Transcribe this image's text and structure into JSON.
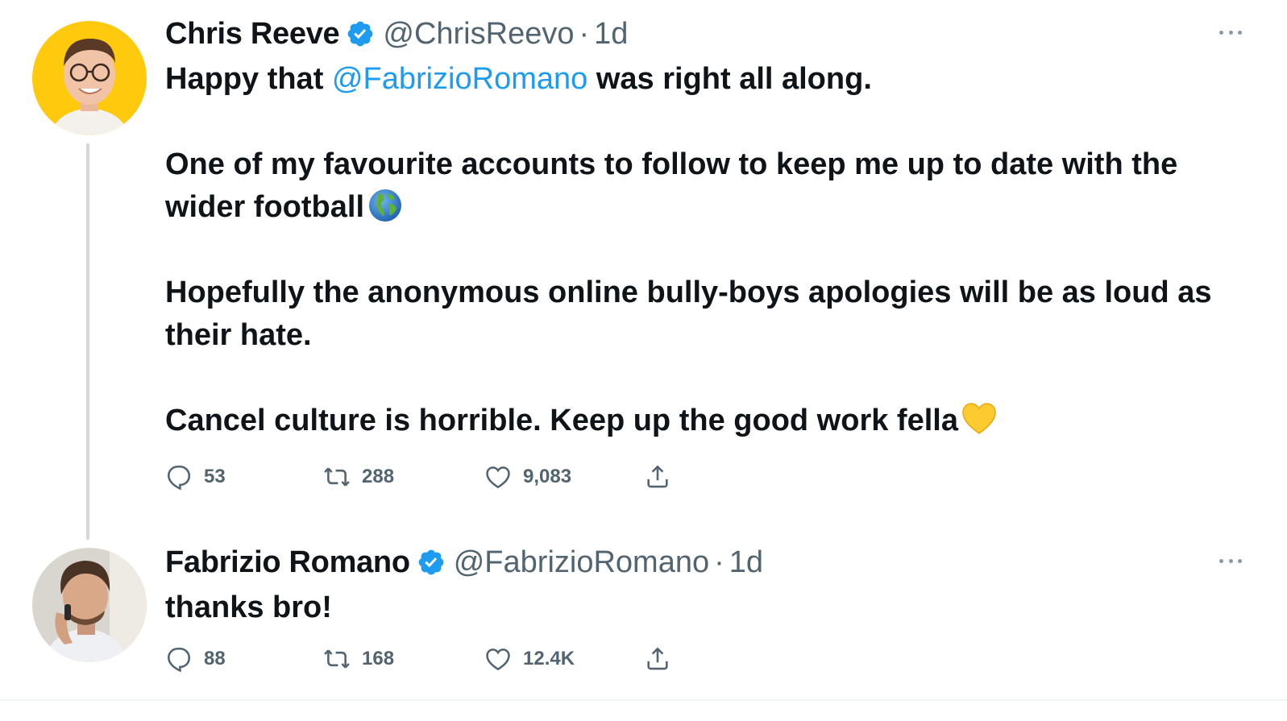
{
  "tweets": [
    {
      "display_name": "Chris Reeve",
      "handle": "@ChrisReevo",
      "separator": "·",
      "time": "1d",
      "text": {
        "p1_before": "Happy that ",
        "p1_mention": "@FabrizioRomano",
        "p1_after": " was right all along.",
        "p2": "One of my favourite accounts to follow to keep me up to date with the wider football",
        "p2_emoji": "globe-europe-africa",
        "p3": "Hopefully the anonymous online bully-boys apologies will be as loud as their hate.",
        "p4": "Cancel culture is horrible. Keep up the good work fella",
        "p4_emoji": "yellow-heart"
      },
      "stats": {
        "replies": "53",
        "retweets": "288",
        "likes": "9,083"
      },
      "avatar_bg": "#ffc90e"
    },
    {
      "display_name": "Fabrizio Romano",
      "handle": "@FabrizioRomano",
      "separator": "·",
      "time": "1d",
      "text": {
        "p1": "thanks bro!"
      },
      "stats": {
        "replies": "88",
        "retweets": "168",
        "likes": "12.4K"
      },
      "avatar_bg": "#d8d4ce"
    }
  ],
  "icons": [
    "verified-badge-icon",
    "more-options-icon",
    "reply-icon",
    "retweet-icon",
    "like-icon",
    "share-icon"
  ],
  "colors": {
    "link": "#1d9bf0",
    "verified": "#1d9bf0",
    "secondary_text": "#536471",
    "thread_line": "#cfd9de"
  }
}
